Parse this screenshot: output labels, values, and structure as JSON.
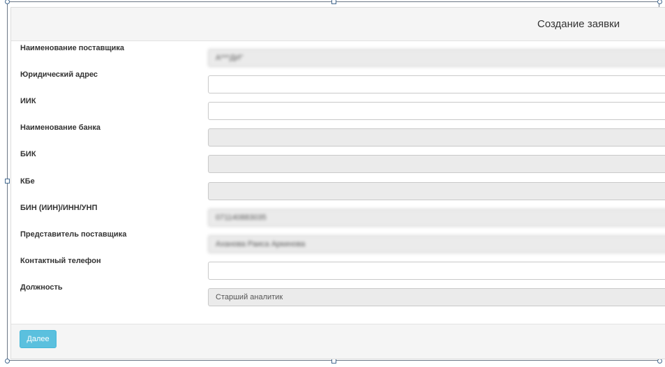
{
  "form": {
    "title": "Создание заявки",
    "fields": [
      {
        "label": "Наименование поставщика",
        "value": "А***ДИ\"",
        "readonly": true,
        "blurred": true
      },
      {
        "label": "Юридический адрес",
        "value": "",
        "readonly": false,
        "blurred": false
      },
      {
        "label": "ИИК",
        "value": "",
        "readonly": false,
        "blurred": false
      },
      {
        "label": "Наименование банка",
        "value": "",
        "readonly": true,
        "blurred": false
      },
      {
        "label": "БИК",
        "value": "",
        "readonly": true,
        "blurred": false
      },
      {
        "label": "КБе",
        "value": "",
        "readonly": true,
        "blurred": false
      },
      {
        "label": "БИН (ИИН)/ИНН/УНП",
        "value": "071140883035",
        "readonly": true,
        "blurred": true
      },
      {
        "label": "Представитель поставщика",
        "value": "Аханова Раиса Аркинова",
        "readonly": true,
        "blurred": true
      },
      {
        "label": "Контактный телефон",
        "value": "",
        "readonly": false,
        "blurred": false
      },
      {
        "label": "Должность",
        "value": "Старший аналитик",
        "readonly": true,
        "blurred": false
      }
    ],
    "next_label": "Далее"
  },
  "colors": {
    "accent": "#5bc0de",
    "header_bg": "#f5f5f5",
    "readonly_bg": "#ebebeb",
    "selection_border": "#42688f"
  }
}
